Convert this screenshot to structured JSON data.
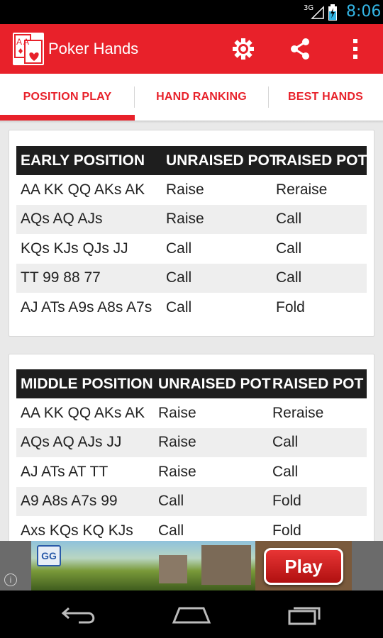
{
  "status_bar": {
    "network": "3G",
    "time": "8:06"
  },
  "app_bar": {
    "title": "Poker Hands",
    "logo_text": "AA"
  },
  "tabs": [
    {
      "label": "POSITION PLAY",
      "selected": true
    },
    {
      "label": "HAND RANKING",
      "selected": false
    },
    {
      "label": "BEST HANDS",
      "selected": false
    }
  ],
  "early_table": {
    "headers": [
      "EARLY POSITION",
      "UNRAISED POT",
      "RAISED POT"
    ],
    "rows": [
      [
        "AA KK QQ AKs AK",
        "Raise",
        "Reraise"
      ],
      [
        "AQs AQ AJs",
        "Raise",
        "Call"
      ],
      [
        "KQs KJs QJs JJ",
        "Call",
        "Call"
      ],
      [
        "TT 99 88 77",
        "Call",
        "Call"
      ],
      [
        "AJ ATs A9s A8s A7s",
        "Call",
        "Fold"
      ]
    ]
  },
  "middle_table": {
    "headers": [
      "MIDDLE POSITION",
      "UNRAISED POT",
      "RAISED POT"
    ],
    "rows": [
      [
        "AA KK QQ AKs AK",
        "Raise",
        "Reraise"
      ],
      [
        "AQs AQ AJs JJ",
        "Raise",
        "Call"
      ],
      [
        "AJ ATs AT TT",
        "Raise",
        "Call"
      ],
      [
        "A9 A8s A7s 99",
        "Call",
        "Fold"
      ],
      [
        "Axs KQs KQ KJs",
        "Call",
        "Fold"
      ]
    ]
  },
  "ad": {
    "play_label": "Play",
    "brand_text": "GG",
    "info_text": "i"
  },
  "colors": {
    "accent": "#e8212a",
    "header_row": "#1e1e1e",
    "status_accent": "#33b5e5"
  }
}
